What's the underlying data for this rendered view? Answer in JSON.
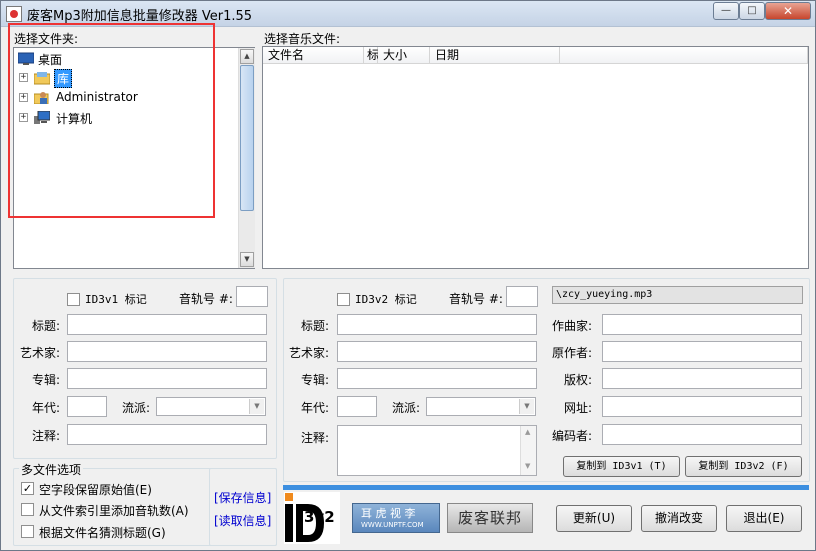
{
  "window": {
    "title": "废客Mp3附加信息批量修改器 Ver1.55",
    "min_label": "—",
    "max_label": "□",
    "close_label": "✕"
  },
  "folder_panel": {
    "label": "选择文件夹:",
    "items": [
      {
        "label": "桌面",
        "icon": "desktop-icon"
      },
      {
        "label": "库",
        "icon": "library-folder-icon"
      },
      {
        "label": "Administrator",
        "icon": "user-folder-icon"
      },
      {
        "label": "计算机",
        "icon": "computer-icon"
      }
    ]
  },
  "music_panel": {
    "label": "选择音乐文件:",
    "columns": [
      "文件名",
      "标",
      "大小",
      "日期"
    ]
  },
  "id3v1": {
    "checkbox_label": "ID3v1 标记",
    "track_label": "音轨号 #:",
    "title_label": "标题:",
    "artist_label": "艺术家:",
    "album_label": "专辑:",
    "year_label": "年代:",
    "genre_label": "流派:",
    "comment_label": "注释:"
  },
  "id3v2": {
    "checkbox_label": "ID3v2 标记",
    "track_label": "音轨号 #:",
    "filename": "\\zcy_yueying.mp3",
    "title_label": "标题:",
    "artist_label": "艺术家:",
    "album_label": "专辑:",
    "year_label": "年代:",
    "genre_label": "流派:",
    "comment_label": "注释:",
    "composer_label": "作曲家:",
    "orig_artist_label": "原作者:",
    "copyright_label": "版权:",
    "url_label": "网址:",
    "encoder_label": "编码者:",
    "copy_v1_label": "复制到 ID3v1 (T)",
    "copy_v2_label": "复制到 ID3v2 (F)"
  },
  "multi_file": {
    "legend": "多文件选项",
    "options": [
      {
        "label": "空字段保留原始值(E)",
        "checked": true
      },
      {
        "label": "从文件索引里添加音轨数(A)",
        "checked": false
      },
      {
        "label": "根据文件名猜测标题(G)",
        "checked": false
      }
    ],
    "save_link": "[保存信息]",
    "read_link": "[读取信息]"
  },
  "logos": {
    "id3v2_text": "3v2",
    "brand1_top": "耳 虎 视 李",
    "brand1_bottom": "WWW.UNPTF.COM",
    "brand2": "废客联邦"
  },
  "buttons": {
    "update": "更新(U)",
    "cancel": "撤消改变",
    "exit": "退出(E)"
  },
  "colors": {
    "accent_bar": "#3c8fe0",
    "link": "#0000d0",
    "highlight": "#e33333"
  }
}
